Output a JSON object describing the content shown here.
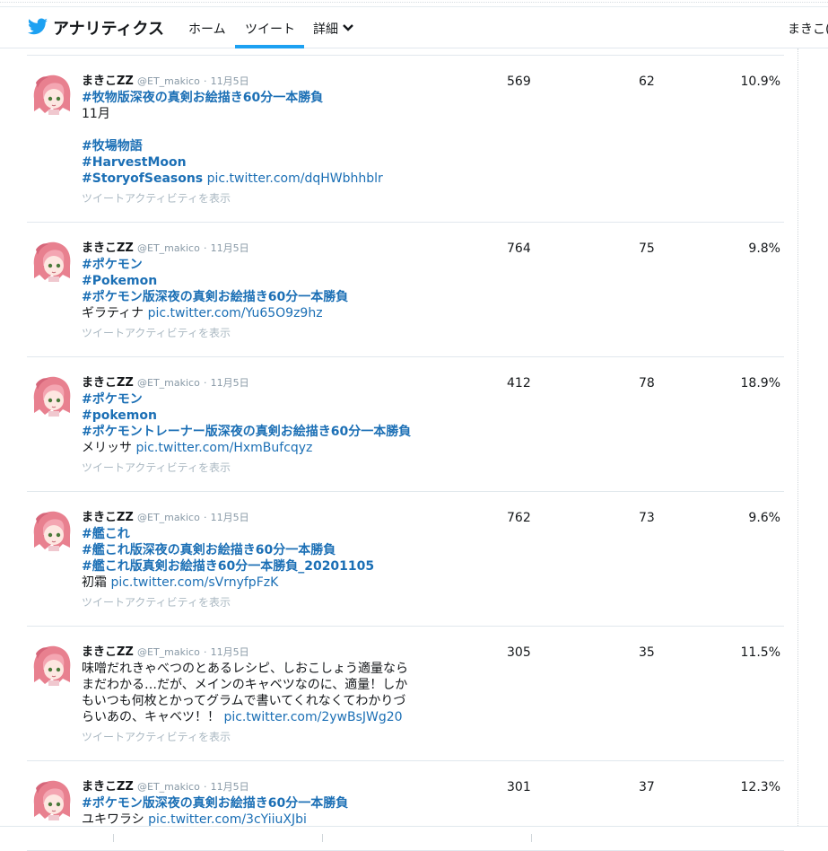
{
  "header": {
    "brand": "アナリティクス",
    "nav_home": "ホーム",
    "nav_tweet": "ツイート",
    "nav_detail": "詳細",
    "user": "まきこ("
  },
  "colors": {
    "link": "#1b6fb5",
    "tab_active": "#1da1f2",
    "muted": "#aab8c2"
  },
  "tweets": [
    {
      "name": "まきこZZ",
      "handle": "@ET_makico",
      "dot": "·",
      "date": "11月5日",
      "lines": [
        {
          "parts": [
            {
              "t": "#牧物版深夜の真剣お絵描き60分一本勝負",
              "k": "hashtag"
            }
          ]
        },
        {
          "parts": [
            {
              "t": "11月",
              "k": "text"
            }
          ]
        },
        {
          "parts": [
            {
              "t": "",
              "k": "text"
            }
          ]
        },
        {
          "parts": [
            {
              "t": "#牧場物語",
              "k": "hashtag"
            }
          ]
        },
        {
          "parts": [
            {
              "t": "#HarvestMoon",
              "k": "hashtag"
            }
          ]
        },
        {
          "parts": [
            {
              "t": "#StoryofSeasons",
              "k": "hashtag"
            },
            {
              "t": " ",
              "k": "text"
            },
            {
              "t": "pic.twitter.com/dqHWbhhblr",
              "k": "link"
            }
          ]
        }
      ],
      "activity": "ツイートアクティビティを表示",
      "impressions": "569",
      "engagements": "62",
      "rate": "10.9%"
    },
    {
      "name": "まきこZZ",
      "handle": "@ET_makico",
      "dot": "·",
      "date": "11月5日",
      "lines": [
        {
          "parts": [
            {
              "t": "#ポケモン",
              "k": "hashtag"
            }
          ]
        },
        {
          "parts": [
            {
              "t": "#Pokemon",
              "k": "hashtag"
            }
          ]
        },
        {
          "parts": [
            {
              "t": "#ポケモン版深夜の真剣お絵描き60分一本勝負",
              "k": "hashtag"
            }
          ]
        },
        {
          "parts": [
            {
              "t": "ギラティナ ",
              "k": "text"
            },
            {
              "t": "pic.twitter.com/Yu65O9z9hz",
              "k": "link"
            }
          ]
        }
      ],
      "activity": "ツイートアクティビティを表示",
      "impressions": "764",
      "engagements": "75",
      "rate": "9.8%"
    },
    {
      "name": "まきこZZ",
      "handle": "@ET_makico",
      "dot": "·",
      "date": "11月5日",
      "lines": [
        {
          "parts": [
            {
              "t": "#ポケモン",
              "k": "hashtag"
            }
          ]
        },
        {
          "parts": [
            {
              "t": "#pokemon",
              "k": "hashtag"
            }
          ]
        },
        {
          "parts": [
            {
              "t": "#ポケモントレーナー版深夜の真剣お絵描き60分一本勝負",
              "k": "hashtag"
            }
          ]
        },
        {
          "parts": [
            {
              "t": "メリッサ ",
              "k": "text"
            },
            {
              "t": "pic.twitter.com/HxmBufcqyz",
              "k": "link"
            }
          ]
        }
      ],
      "activity": "ツイートアクティビティを表示",
      "impressions": "412",
      "engagements": "78",
      "rate": "18.9%"
    },
    {
      "name": "まきこZZ",
      "handle": "@ET_makico",
      "dot": "·",
      "date": "11月5日",
      "lines": [
        {
          "parts": [
            {
              "t": "#艦これ",
              "k": "hashtag"
            }
          ]
        },
        {
          "parts": [
            {
              "t": "#艦これ版深夜の真剣お絵描き60分一本勝負",
              "k": "hashtag"
            }
          ]
        },
        {
          "parts": [
            {
              "t": "#艦これ版真剣お絵描き60分一本勝負_20201105",
              "k": "hashtag"
            }
          ]
        },
        {
          "parts": [
            {
              "t": "初霜 ",
              "k": "text"
            },
            {
              "t": "pic.twitter.com/sVrnyfpFzK",
              "k": "link"
            }
          ]
        }
      ],
      "activity": "ツイートアクティビティを表示",
      "impressions": "762",
      "engagements": "73",
      "rate": "9.6%"
    },
    {
      "name": "まきこZZ",
      "handle": "@ET_makico",
      "dot": "·",
      "date": "11月5日",
      "lines": [
        {
          "parts": [
            {
              "t": "味噌だれきゃべつのとあるレシピ、しおこしょう適量なら",
              "k": "text"
            }
          ]
        },
        {
          "parts": [
            {
              "t": "まだわかる…だが、メインのキャベツなのに、適量！しか",
              "k": "text"
            }
          ]
        },
        {
          "parts": [
            {
              "t": "もいつも何枚とかってグラムで書いてくれなくてわかりづ",
              "k": "text"
            }
          ]
        },
        {
          "parts": [
            {
              "t": "らいあの、キャベツ！！ ",
              "k": "text"
            },
            {
              "t": "pic.twitter.com/2ywBsJWg20",
              "k": "link"
            }
          ]
        }
      ],
      "activity": "ツイートアクティビティを表示",
      "impressions": "305",
      "engagements": "35",
      "rate": "11.5%"
    },
    {
      "name": "まきこZZ",
      "handle": "@ET_makico",
      "dot": "·",
      "date": "11月5日",
      "lines": [
        {
          "parts": [
            {
              "t": "#ポケモン版深夜の真剣お絵描き60分一本勝負",
              "k": "hashtag"
            }
          ]
        },
        {
          "parts": [
            {
              "t": "ユキワラシ ",
              "k": "text"
            },
            {
              "t": "pic.twitter.com/3cYiiuXJbi",
              "k": "link"
            }
          ]
        }
      ],
      "activity": "",
      "impressions": "301",
      "engagements": "37",
      "rate": "12.3%"
    }
  ]
}
